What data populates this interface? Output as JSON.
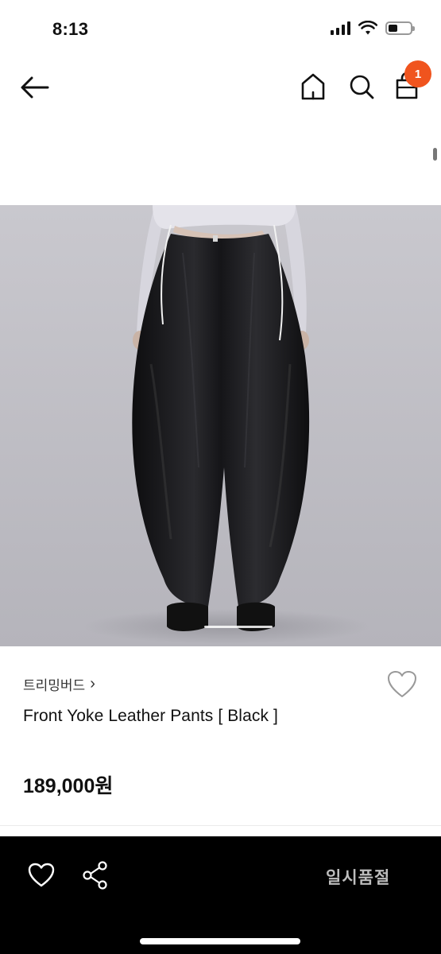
{
  "status_bar": {
    "time": "8:13"
  },
  "header": {
    "cart_count": "1"
  },
  "product": {
    "brand": "트리밍버드",
    "brand_chevron": "›",
    "title": "Front Yoke Leather Pants [ Black ]",
    "price": "189,000원"
  },
  "bottom_bar": {
    "soldout_label": "일시품절"
  },
  "colors": {
    "accent": "#f0541e",
    "bottom_bar": "#000000",
    "soldout_text": "#bdbdbd"
  },
  "icons": [
    "back-arrow-icon",
    "home-icon",
    "search-icon",
    "shopping-bag-icon",
    "heart-icon",
    "share-icon"
  ]
}
